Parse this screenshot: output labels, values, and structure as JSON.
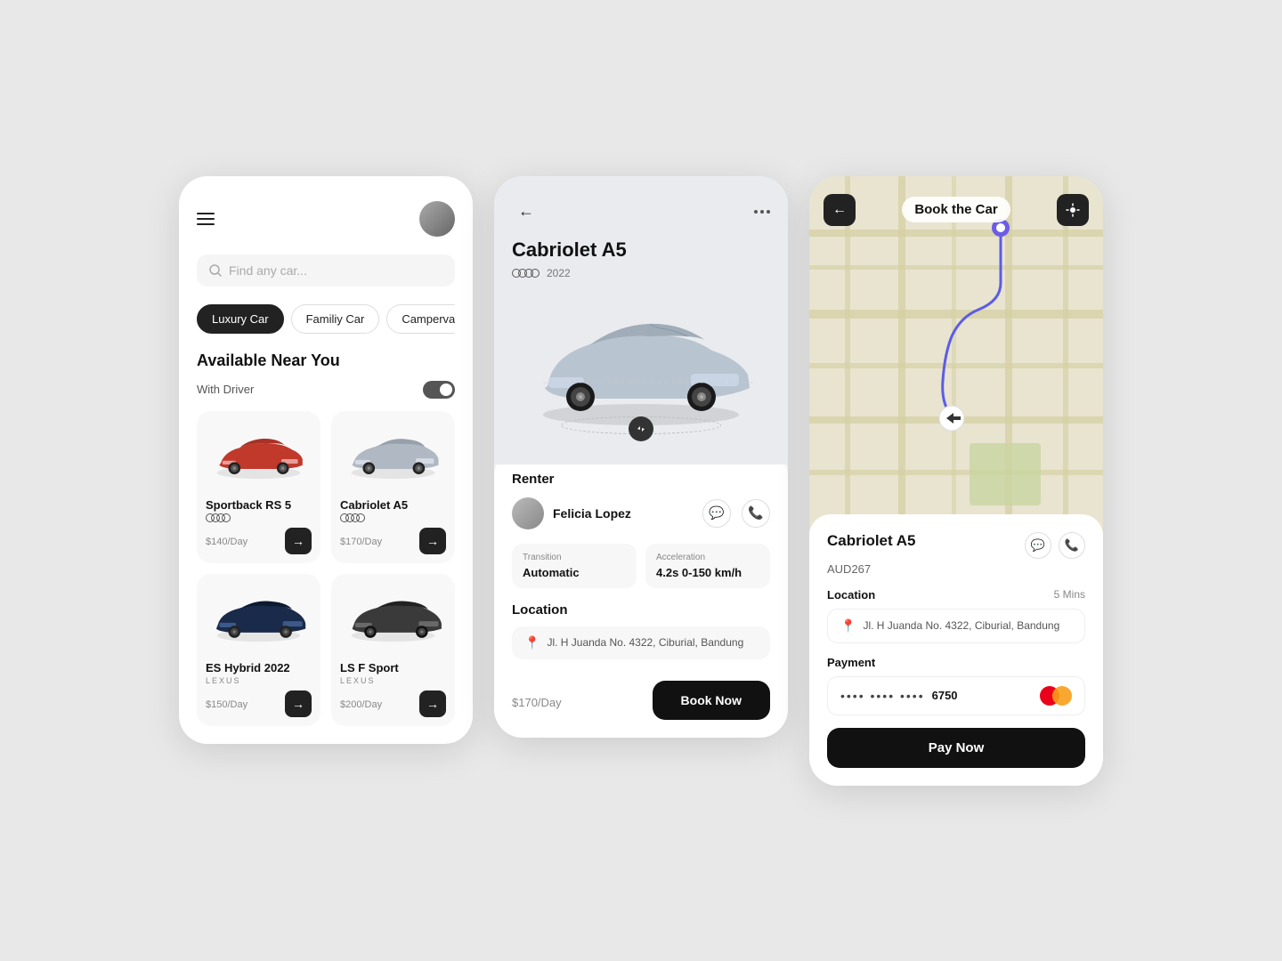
{
  "screen1": {
    "menu_icon": "hamburger-menu",
    "search_placeholder": "Find any car...",
    "filters": [
      {
        "label": "Luxury Car",
        "active": true
      },
      {
        "label": "Familiy Car",
        "active": false
      },
      {
        "label": "Campervan",
        "active": false
      }
    ],
    "section_title": "Available Near You",
    "with_driver_label": "With Driver",
    "cars": [
      {
        "name": "Sportback RS 5",
        "brand": "AUDI",
        "price": "$140",
        "per": "/Day",
        "color": "red"
      },
      {
        "name": "Cabriolet A5",
        "brand": "AUDI",
        "price": "$170",
        "per": "/Day",
        "color": "gray"
      },
      {
        "name": "ES Hybrid 2022",
        "brand": "LEXUS",
        "price": "$150",
        "per": "/Day",
        "color": "darkblue"
      },
      {
        "name": "LS F Sport",
        "brand": "LEXUS",
        "price": "$200",
        "per": "/Day",
        "color": "darkgray"
      }
    ]
  },
  "screen2": {
    "car_name": "Cabriolet A5",
    "brand": "AUDI",
    "year": "2022",
    "renter_label": "Renter",
    "renter_name": "Felicia Lopez",
    "transition_label": "Transition",
    "transition_value": "Automatic",
    "acceleration_label": "Acceleration",
    "acceleration_value": "4.2s  0-150 km/h",
    "location_label": "Location",
    "location_value": "Jl. H Juanda No. 4322, Ciburial, Bandung",
    "price": "$170",
    "per_day": "/Day",
    "book_btn": "Book Now"
  },
  "screen3": {
    "title": "Book the Car",
    "car_name": "Cabriolet A5",
    "price": "AUD267",
    "location_label": "Location",
    "location_time": "5 Mins",
    "location_value": "Jl. H Juanda No. 4322, Ciburial, Bandung",
    "payment_label": "Payment",
    "card_dots": "•••• •••• ••••",
    "card_number": "6750",
    "pay_btn": "Pay Now"
  }
}
